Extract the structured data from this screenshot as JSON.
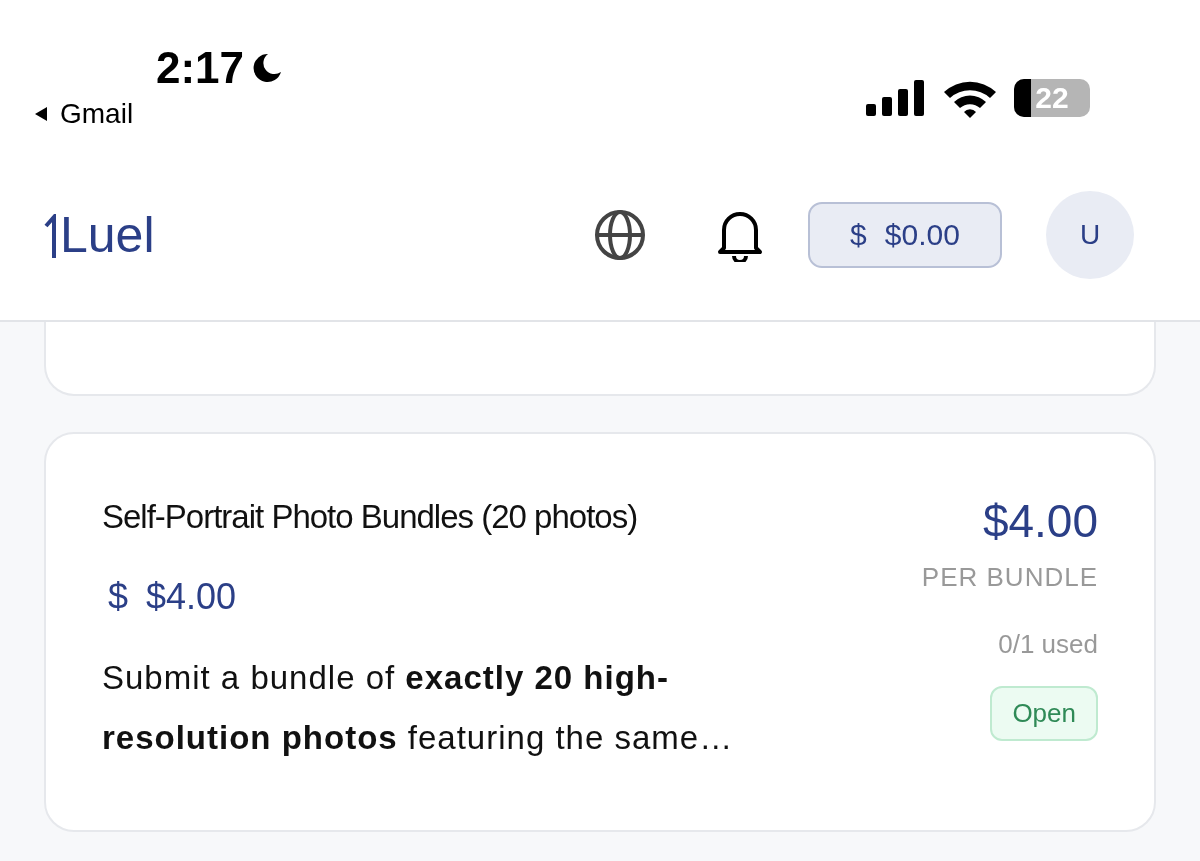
{
  "status_bar": {
    "time": "2:17",
    "back_label": "Gmail",
    "battery": "22"
  },
  "header": {
    "logo": "Luel",
    "balance": "$0.00",
    "balance_symbol": "$",
    "avatar": "U"
  },
  "listings": [
    {
      "title": "Self-Portrait Photo Bundles (20 photos)",
      "symbol": "$",
      "price": "$4.00",
      "description": "Submit a bundle of **exactly 20 high-resolution photos** featuring the same…",
      "amount": "$4.00",
      "unit": "PER BUNDLE",
      "usage": "0/1 used",
      "status": "Open"
    }
  ]
}
